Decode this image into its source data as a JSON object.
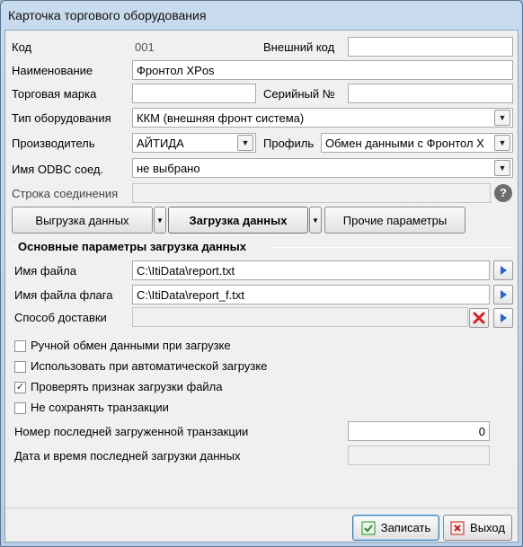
{
  "window": {
    "title": "Карточка торгового оборудования"
  },
  "form": {
    "code_label": "Код",
    "code_value": "001",
    "external_code_label": "Внешний код",
    "external_code_value": "",
    "name_label": "Наименование",
    "name_value": "Фронтол XPos",
    "brand_label": "Торговая марка",
    "brand_value": "",
    "serial_label": "Серийный №",
    "serial_value": "",
    "type_label": "Тип оборудования",
    "type_value": "ККМ (внешняя фронт система)",
    "manufacturer_label": "Производитель",
    "manufacturer_value": "АЙТИДА",
    "profile_label": "Профиль",
    "profile_value": "Обмен данными с Фронтол X",
    "odbc_label": "Имя ODBC соед.",
    "odbc_value": "не выбрано",
    "conn_string_label": "Строка соединения",
    "conn_string_value": ""
  },
  "tabs": {
    "export_label": "Выгрузка данных",
    "import_label": "Загрузка данных",
    "other_label": "Прочие параметры"
  },
  "import_section": {
    "title": "Основные параметры загрузка данных",
    "file_name_label": "Имя файла",
    "file_name_value": "C:\\ItiData\\report.txt",
    "flag_file_label": "Имя файла флага",
    "flag_file_value": "C:\\ItiData\\report_f.txt",
    "delivery_label": "Способ доставки",
    "delivery_value": "",
    "checkboxes": [
      {
        "label": "Ручной обмен данными при загрузке",
        "checked": false
      },
      {
        "label": "Использовать при автоматической загрузке",
        "checked": false
      },
      {
        "label": "Проверять признак загрузки файла",
        "checked": true
      },
      {
        "label": "Не сохранять транзакции",
        "checked": false
      }
    ],
    "last_txn_label": "Номер последней загруженной транзакции",
    "last_txn_value": "0",
    "last_load_label": "Дата и время последней загрузки данных",
    "last_load_value": ""
  },
  "footer": {
    "save_label": "Записать",
    "exit_label": "Выход"
  },
  "icons": {
    "help": "help-icon",
    "dropdown": "chevron-down-icon",
    "browse": "arrow-right-icon",
    "clear": "red-x-icon",
    "save": "save-icon",
    "exit": "exit-icon"
  },
  "colors": {
    "title_bar": "#c9dbee",
    "client_bg": "#f0f0f0",
    "browse_blue": "#2a66c4",
    "clear_red": "#d42020",
    "save_green": "#2c8a2c"
  }
}
